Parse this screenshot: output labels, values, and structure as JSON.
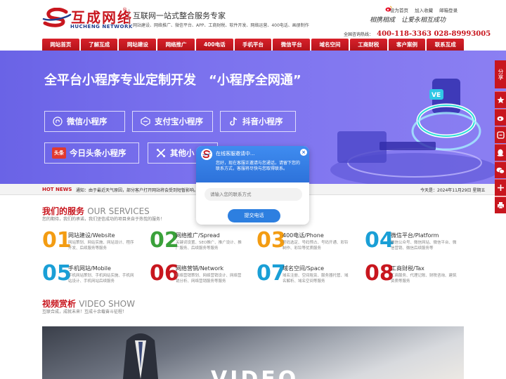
{
  "header": {
    "logo_cn": "互成网络",
    "logo_reg": "®",
    "logo_en": "HUCHENG NETWORK",
    "slogan": "互联网一站式整合服务专家",
    "services": "网站建设、网络推广、微信平台、APP、工商财税、软件开发、网络运营、400电话、画册制作",
    "top_links": [
      "设为首页",
      "加入收藏",
      "邮箱登录"
    ],
    "motto": "相携相成　让爱永相互成功",
    "hotline_label": "全国咨询热线：",
    "hotline_numbers": "400-118-3363  028-89993005"
  },
  "nav": [
    "网站首页",
    "了解互成",
    "网站建设",
    "网络推广",
    "400电话",
    "手机平台",
    "微信平台",
    "域名空间",
    "工商财税",
    "客户案例",
    "联系互成"
  ],
  "banner": {
    "title": "全平台小程序专业定制开发　“小程序全网通”",
    "pills": [
      {
        "label": "微信小程序",
        "icon": "mini-program-icon"
      },
      {
        "label": "支付宝小程序",
        "icon": "alipay-icon"
      },
      {
        "label": "抖音小程序",
        "icon": "douyin-icon"
      },
      {
        "label": "今日头条小程序",
        "icon": "toutiao-icon",
        "icon_text": "头条"
      },
      {
        "label": "其他小",
        "icon": "x-icon"
      }
    ]
  },
  "hotnews": {
    "tag": "HOT NEWS",
    "text": "通知：由于最近天气原因，部分客户打开网站将会受到短暂影响。",
    "date": "今天是：2024年11月29日 星期五"
  },
  "services_section": {
    "title_cn": "我们的服务",
    "title_en": "OUR SERVICES",
    "subtitle": "您的期待，我们的承诺，我们坚信成功的项目来自于热忱的服务！",
    "items": [
      {
        "num": "01",
        "title": "网站建设/Website",
        "desc": "网站策划、网站实施、网站设计、程序开发、后续服务等服务",
        "color": "#f39c12"
      },
      {
        "num": "02",
        "title": "网络推广/Spread",
        "desc": "关键词设置、SEO推广、推广设计、推广服务、后续服务等服务",
        "color": "#3aa13a"
      },
      {
        "num": "03",
        "title": "400电话/Phone",
        "desc": "号码选定、号码预占、号码开通、彩铃制作、彩铃等优质服务",
        "color": "#f39c12"
      },
      {
        "num": "04",
        "title": "微信平台/Platform",
        "desc": "微信公众号、微信网站、微信平台、微信营销、微信后续服务等",
        "color": "#1a9fd6"
      },
      {
        "num": "05",
        "title": "手机网站/Mobile",
        "desc": "手机网站策划、手机网站实施、手机网站设计、手机网站后续服务",
        "color": "#1a9fd6"
      },
      {
        "num": "06",
        "title": "网络营销/Network",
        "desc": "网络营销策划、网络营销设计、网络营销分析、网络营销服务等服务",
        "color": "#c8161e"
      },
      {
        "num": "07",
        "title": "域名空间/Space",
        "desc": "域名注册、空间租赁、服务器托管、域名解析、域名空间等服务",
        "color": "#1a9fd6"
      },
      {
        "num": "08",
        "title": "工商财税/Tax",
        "desc": "工商服务、代理记账、财税咨询、建筑资质等服务",
        "color": "#c8161e"
      }
    ]
  },
  "video_section": {
    "title_cn": "视频赏析",
    "title_en": "VIDEO SHOW",
    "subtitle": "互联合成，成就未来！互成十余载奋斗征程！",
    "overlay_text": "VIDEO"
  },
  "share": {
    "label": "分享"
  },
  "chat": {
    "title": "在线客服邀请中...",
    "message": "您好，现在客服正邀请与您通话，请留下您的联系方式，客服将尽快与您取得联系。",
    "input_placeholder": "请输入您的联系方式",
    "submit": "提交电话",
    "close": "×"
  },
  "colors": {
    "brand": "#c8161e",
    "banner": "#7b72ee",
    "chat": "#2d7fe0"
  }
}
